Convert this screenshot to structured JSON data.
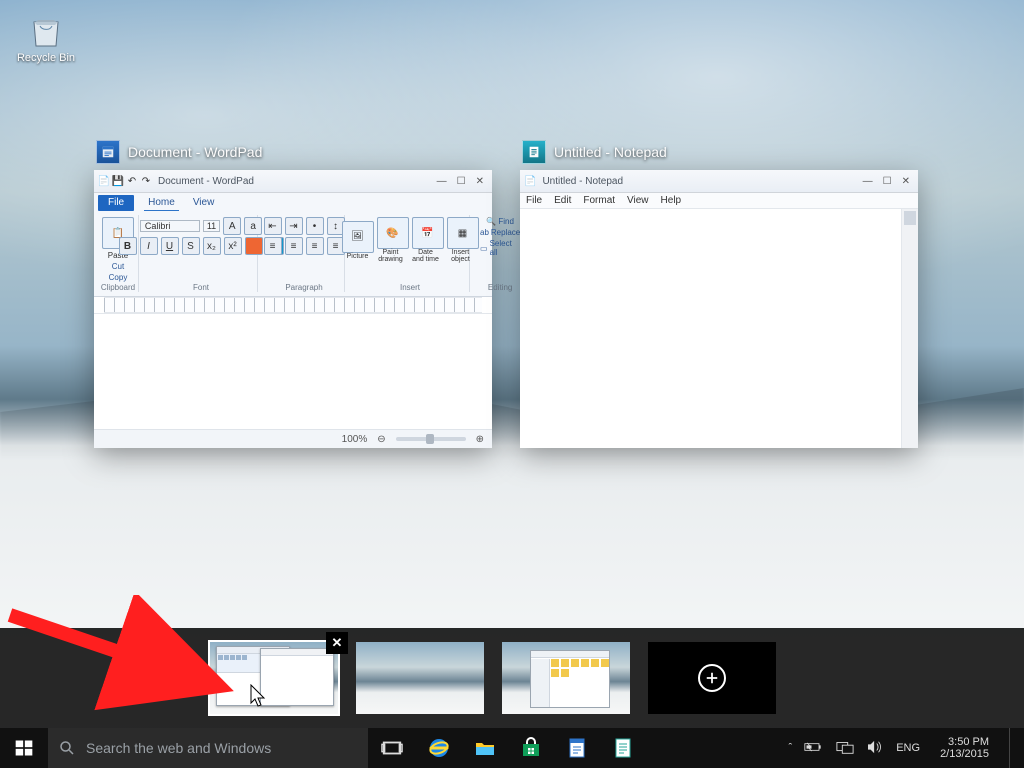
{
  "desktop": {
    "recycle_bin": "Recycle Bin"
  },
  "task_view": {
    "windows": [
      {
        "id": "wordpad",
        "title": "Document - WordPad",
        "inner_title": "Document - WordPad",
        "tabs": {
          "file": "File",
          "home": "Home",
          "view": "View"
        },
        "groups": {
          "clipboard": "Clipboard",
          "paste": "Paste",
          "cut": "Cut",
          "copy": "Copy",
          "font": "Font",
          "font_family": "Calibri",
          "font_size": "11",
          "paragraph": "Paragraph",
          "insert": "Insert",
          "picture": "Picture",
          "paint": "Paint drawing",
          "datetime": "Date and time",
          "object": "Insert object",
          "editing": "Editing",
          "find": "Find",
          "replace": "Replace",
          "select_all": "Select all"
        },
        "zoom": "100%"
      },
      {
        "id": "notepad",
        "title": "Untitled - Notepad",
        "inner_title": "Untitled - Notepad",
        "menu": {
          "file": "File",
          "edit": "Edit",
          "format": "Format",
          "view": "View",
          "help": "Help"
        }
      }
    ],
    "desktops": {
      "count": 3,
      "active_index": 0,
      "new_label": "New desktop"
    }
  },
  "taskbar": {
    "search_placeholder": "Search the web and Windows",
    "language": "ENG",
    "time": "3:50 PM",
    "date": "2/13/2015"
  }
}
